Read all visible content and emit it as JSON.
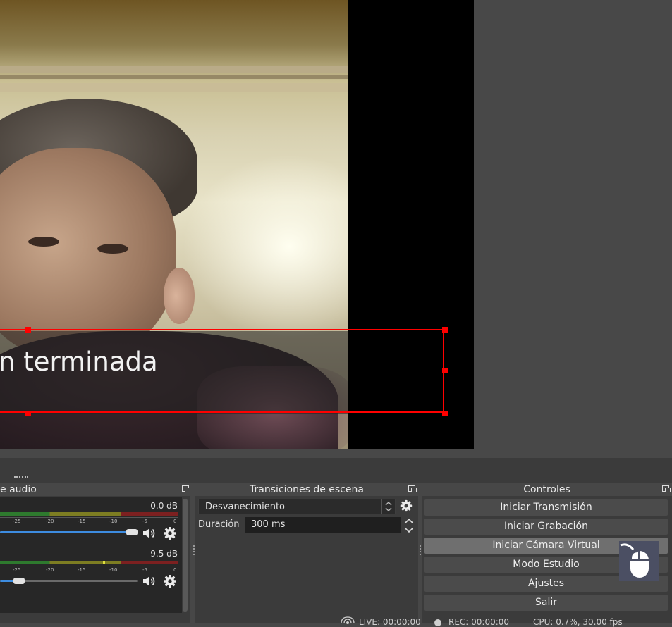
{
  "preview": {
    "caption_text": "n terminada"
  },
  "audio_mixer": {
    "title": "e audio",
    "channels": [
      {
        "db": "0.0 dB",
        "volume_level": 0.97
      },
      {
        "db": "-9.5 dB",
        "volume_level": 0.14
      }
    ],
    "meter_ticks": [
      "-25",
      "-20",
      "-15",
      "-10",
      "-5",
      "0"
    ]
  },
  "transitions": {
    "title": "Transiciones de escena",
    "selected": "Desvanecimiento",
    "duration_label": "Duración",
    "duration_value": "300 ms"
  },
  "controls": {
    "title": "Controles",
    "buttons": [
      "Iniciar Transmisión",
      "Iniciar Grabación",
      "Iniciar Cámara Virtual",
      "Modo Estudio",
      "Ajustes",
      "Salir"
    ]
  },
  "status_bar": {
    "live": "LIVE: 00:00:00",
    "rec": "REC: 00:00:00",
    "cpu": "CPU: 0.7%, 30.00 fps"
  },
  "colors": {
    "selection": "#ff0000",
    "volume_fill": "#3d8ce0",
    "meter_green": "#2e7a2e",
    "meter_yellow": "#7d7d22",
    "meter_red": "#7c2020"
  }
}
